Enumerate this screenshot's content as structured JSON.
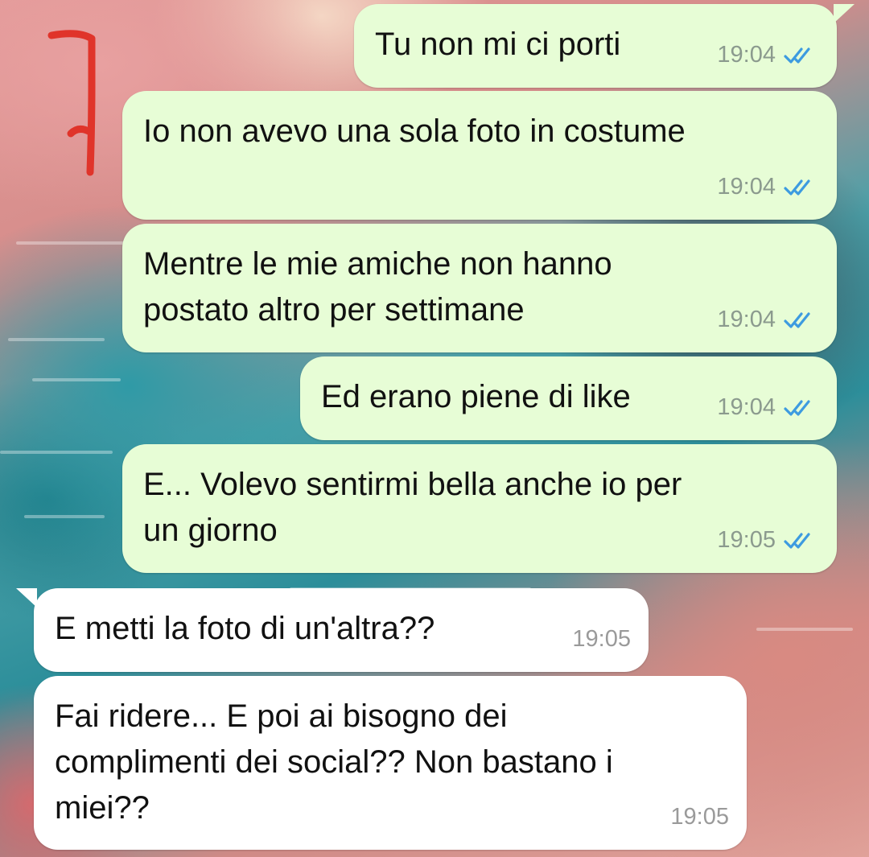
{
  "messages": [
    {
      "direction": "out",
      "text": "Tu non mi ci porti",
      "time": "19:04",
      "status": "read"
    },
    {
      "direction": "out",
      "text": "Io non avevo una sola foto in costume",
      "time": "19:04",
      "status": "read"
    },
    {
      "direction": "out",
      "text": "Mentre le mie amiche non hanno\npostato altro per settimane",
      "time": "19:04",
      "status": "read"
    },
    {
      "direction": "out",
      "text": "Ed erano piene di like",
      "time": "19:04",
      "status": "read"
    },
    {
      "direction": "out",
      "text": "E... Volevo sentirmi bella anche io per\nun giorno",
      "time": "19:05",
      "status": "read"
    },
    {
      "direction": "in",
      "text": "E metti la foto di un'altra??",
      "time": "19:05"
    },
    {
      "direction": "in",
      "text": "Fai ridere... E poi ai bisogno dei\ncomplimenti dei social?? Non bastano i\nmiei??",
      "time": "19:05"
    }
  ],
  "colors": {
    "outgoing_bubble": "#e7fdd6",
    "incoming_bubble": "#ffffff",
    "read_ticks": "#3d9be0",
    "annotation_marker": "#e0342a"
  },
  "icons": {
    "read_receipt": "double-check-icon",
    "annotation": "red-bracket-marker"
  }
}
